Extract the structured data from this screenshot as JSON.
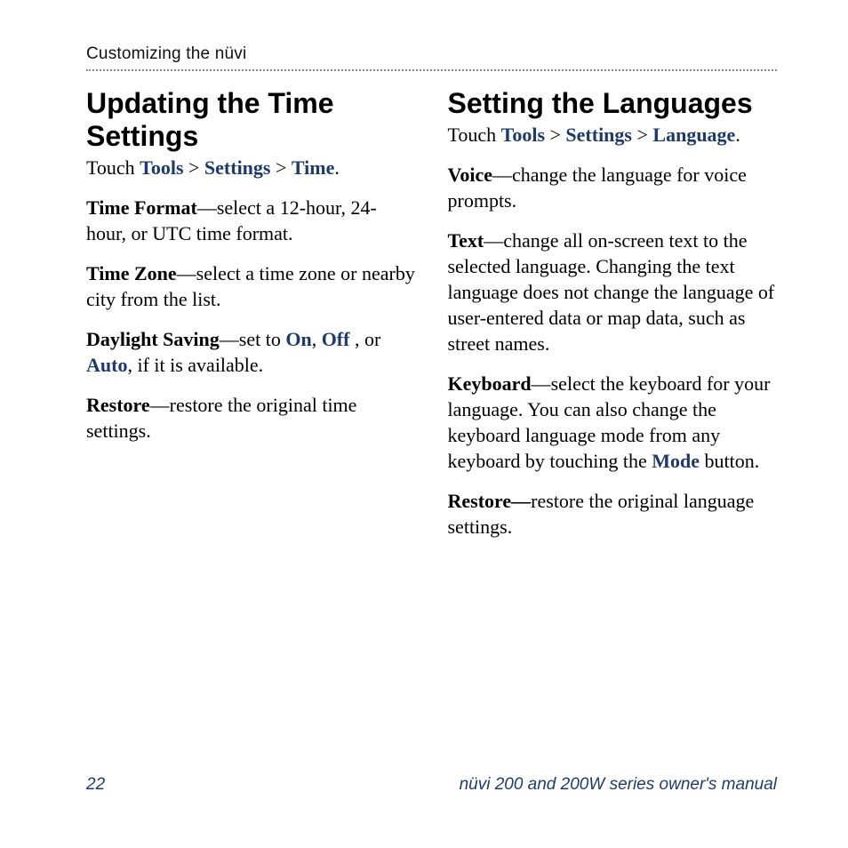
{
  "header": {
    "running": "Customizing the nüvi"
  },
  "left": {
    "title": "Updating the Time Settings",
    "nav": {
      "prefix": "Touch ",
      "a": "Tools",
      "b": "Settings",
      "c": "Time",
      "sep": " > ",
      "end": "."
    },
    "p1": {
      "lead": "Time Format",
      "dash": "—",
      "rest": "select a 12-hour, 24-hour, or UTC time format."
    },
    "p2": {
      "lead": "Time Zone",
      "dash": "—",
      "rest": "select a time zone or nearby city from the list."
    },
    "p3": {
      "lead": "Daylight Saving",
      "dash": "—",
      "pre": "set to ",
      "on": "On",
      "comma1": ", ",
      "off": "Off",
      "comma2": " , or ",
      "auto": "Auto",
      "rest": ", if it is available."
    },
    "p4": {
      "lead": "Restore",
      "dash": "—",
      "rest": "restore the original time settings."
    }
  },
  "right": {
    "title": "Setting the Languages",
    "nav": {
      "prefix": "Touch ",
      "a": "Tools",
      "b": "Settings",
      "c": "Language",
      "sep": " > ",
      "end": "."
    },
    "p1": {
      "lead": "Voice",
      "dash": "—",
      "rest": "change the language for voice prompts."
    },
    "p2": {
      "lead": "Text",
      "dash": "—",
      "rest": "change all on-screen text to the selected language. Changing the text language does not change the language of user-entered data or map data, such as street names."
    },
    "p3": {
      "lead": "Keyboard",
      "dash": "—",
      "pre": "select the keyboard for your language. You can also change the keyboard language mode from any keyboard by touching the ",
      "mode": "Mode",
      "rest": " button."
    },
    "p4": {
      "lead": "Restore—",
      "rest": "restore the original language settings."
    }
  },
  "footer": {
    "page": "22",
    "title": "nüvi 200 and 200W series owner's manual"
  }
}
